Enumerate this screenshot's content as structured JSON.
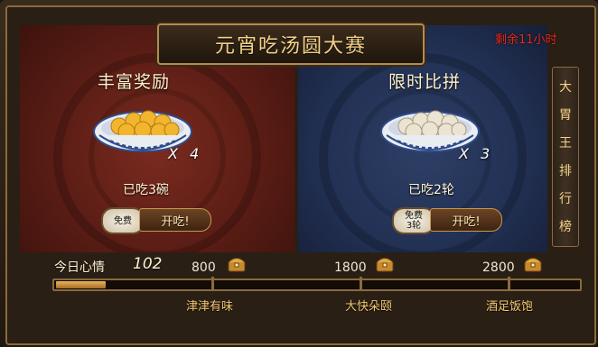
{
  "header": {
    "title": "元宵吃汤圆大赛",
    "countdown": "剩余11小时"
  },
  "left_panel": {
    "title": "丰富奖励",
    "quantity": "X 4",
    "eaten": "已吃3碗",
    "free_badge_line1": "免费",
    "free_badge_line2": "",
    "button": "开吃!",
    "colors": {
      "dumpling": "#f2b62e",
      "panel": "#5a1d15"
    }
  },
  "right_panel": {
    "title": "限时比拼",
    "quantity": "X 3",
    "eaten": "已吃2轮",
    "free_badge_line1": "免费",
    "free_badge_line2": "3轮",
    "button": "开吃!",
    "colors": {
      "dumpling": "#ece4d2",
      "panel": "#223154"
    }
  },
  "side_tab": {
    "chars": [
      "大",
      "胃",
      "王",
      "排",
      "行",
      "榜"
    ]
  },
  "progress": {
    "label": "今日心情",
    "value": "102",
    "value_num": 102,
    "max": 2800,
    "milestones": [
      {
        "value": "800",
        "name": "津津有味",
        "icon": "treasure-chest-icon"
      },
      {
        "value": "1800",
        "name": "大快朵颐",
        "icon": "treasure-chest-icon"
      },
      {
        "value": "2800",
        "name": "酒足饭饱",
        "icon": "treasure-chest-icon"
      }
    ]
  }
}
